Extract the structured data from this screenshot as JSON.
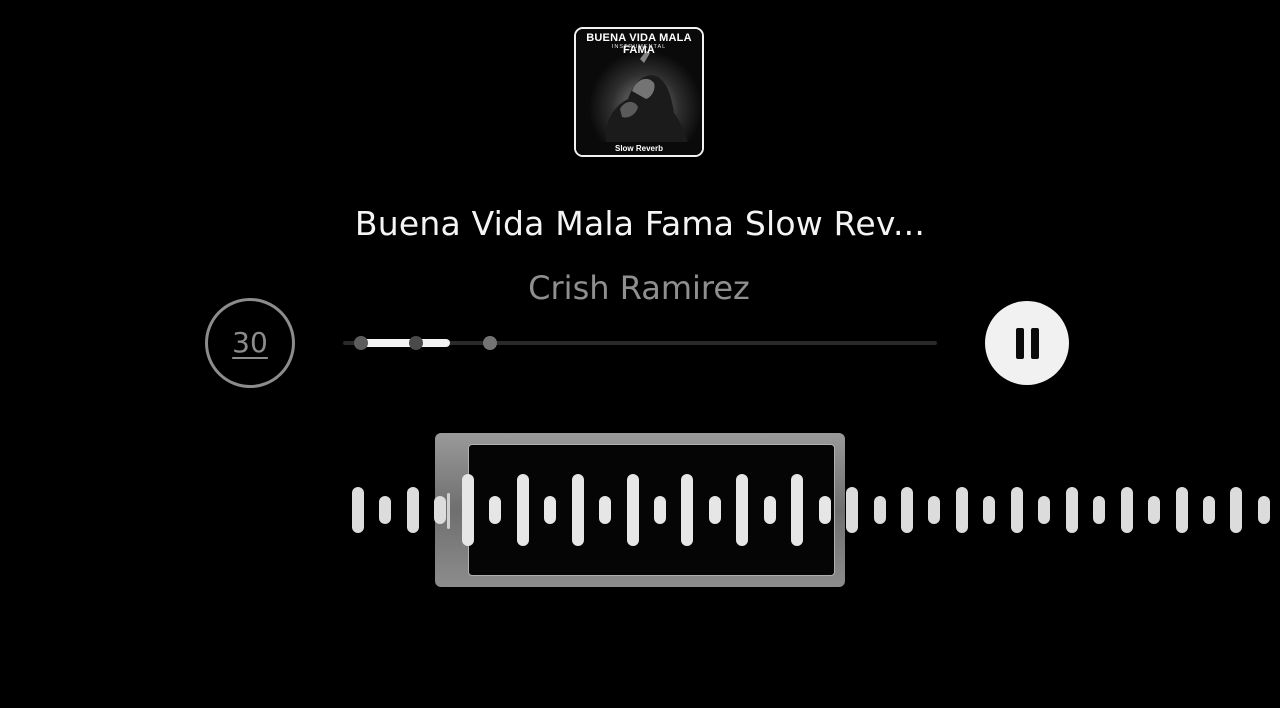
{
  "album_art": {
    "title": "BUENA VIDA MALA FAMA",
    "subtitle": "INSTRUMENTAL",
    "footer": "Slow Reverb"
  },
  "track": {
    "title": "Buena Vida Mala Fama Slow Rev...",
    "artist": "Crish Ramirez"
  },
  "controls": {
    "skip_label": "30",
    "skip_icon": "skip-30-icon",
    "pause_icon": "pause-icon"
  },
  "progress": {
    "fraction": 0.18
  },
  "colors": {
    "background": "#000000",
    "accent": "#f1f1f1",
    "muted": "#8c8c8c"
  }
}
